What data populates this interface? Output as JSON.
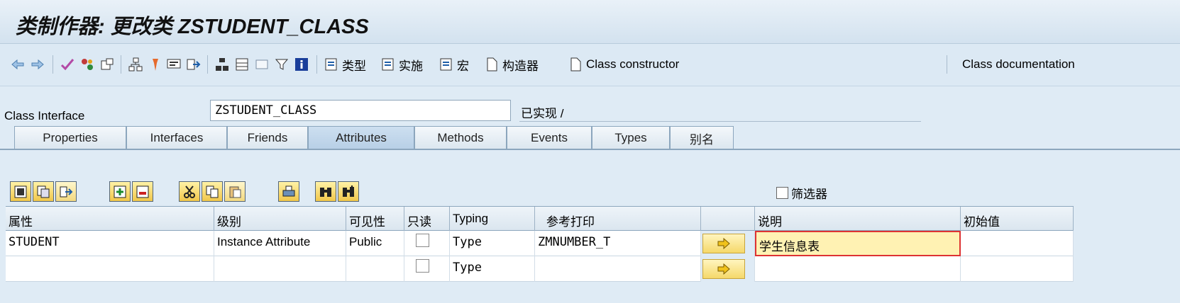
{
  "window": {
    "title": "类制作器: 更改类 ZSTUDENT_CLASS"
  },
  "toolbar": {
    "icons": [
      "back-arrow-icon",
      "forward-arrow-icon",
      "check-icon",
      "activate-icon",
      "where-used-icon",
      "hierarchy-icon",
      "pin-icon",
      "display-object-icon",
      "navigate-icon",
      "object-list-icon",
      "tree-icon",
      "frame-icon",
      "filter-icon",
      "info-icon"
    ],
    "btn_type": "类型",
    "btn_impl": "实施",
    "btn_macro": "宏",
    "btn_constructor_cn": "构造器",
    "btn_class_constructor": "Class constructor",
    "btn_class_doc": "Class documentation"
  },
  "class_interface": {
    "label": "Class Interface",
    "value": "ZSTUDENT_CLASS",
    "status": "已实现 /"
  },
  "tabs": [
    {
      "label": "Properties",
      "active": false
    },
    {
      "label": "Interfaces",
      "active": false
    },
    {
      "label": "Friends",
      "active": false
    },
    {
      "label": "Attributes",
      "active": true
    },
    {
      "label": "Methods",
      "active": false
    },
    {
      "label": "Events",
      "active": false
    },
    {
      "label": "Types",
      "active": false
    },
    {
      "label": "别名",
      "active": false
    }
  ],
  "grid_toolbar": {
    "icons": [
      "details-icon",
      "copy-row-icon",
      "navigate-icon",
      "insert-row-icon",
      "delete-row-icon",
      "cut-icon",
      "copy-icon",
      "paste-icon",
      "print-icon",
      "find-icon",
      "find-next-icon"
    ]
  },
  "filter": {
    "label": "筛选器",
    "checked": false
  },
  "table": {
    "columns": [
      "属性",
      "级别",
      "可见性",
      "只读",
      "Typing",
      "参考打印",
      "",
      "说明",
      "初始值"
    ],
    "rows": [
      {
        "attribute": "STUDENT",
        "level": "Instance Attribute",
        "visibility": "Public",
        "readonly": false,
        "typing": "Type",
        "reference": "ZMNUMBER_T",
        "description": "学生信息表",
        "initial": ""
      },
      {
        "attribute": "",
        "level": "",
        "visibility": "",
        "readonly": false,
        "typing": "Type",
        "reference": "",
        "description": "",
        "initial": ""
      }
    ]
  },
  "colors": {
    "accent": "#f5d86a",
    "tab_active": "#b7cfe6",
    "background": "#dfebf5"
  }
}
